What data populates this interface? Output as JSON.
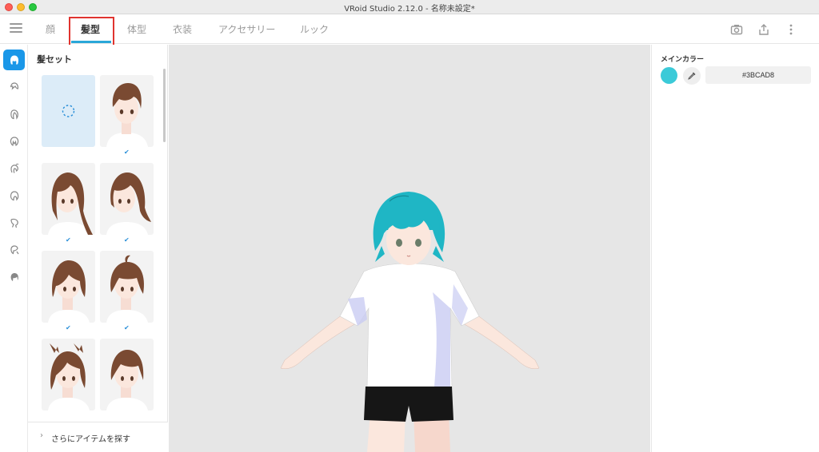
{
  "window": {
    "title": "VRoid Studio 2.12.0 - 名称未設定*"
  },
  "tabs": [
    {
      "label": "顔",
      "active": false
    },
    {
      "label": "髪型",
      "active": true
    },
    {
      "label": "体型",
      "active": false
    },
    {
      "label": "衣装",
      "active": false
    },
    {
      "label": "アクセサリー",
      "active": false
    },
    {
      "label": "ルック",
      "active": false
    }
  ],
  "toolbar_icons": [
    "camera-icon",
    "export-icon",
    "more-vertical-icon"
  ],
  "rail_icons": [
    "hair-set-icon",
    "front-hair-icon",
    "back-hair-icon",
    "side-hair-icon",
    "ahoge-icon",
    "base-hair-icon",
    "sub-hair-icon",
    "hair-extra-icon",
    "hair-edit-icon"
  ],
  "panel": {
    "title": "髪セット",
    "more_label": "さらにアイテムを探す",
    "items": [
      {
        "name": "loading-slot",
        "checked": false
      },
      {
        "name": "short-hair",
        "checked": true
      },
      {
        "name": "long-straight-hair",
        "checked": true
      },
      {
        "name": "medium-hair",
        "checked": true
      },
      {
        "name": "bob-hair",
        "checked": true
      },
      {
        "name": "ahoge-bob-hair",
        "checked": true
      },
      {
        "name": "bun-hair",
        "checked": true
      },
      {
        "name": "short-bob-hair",
        "checked": true
      }
    ]
  },
  "properties": {
    "main_color_label": "メインカラー",
    "main_color_hex": "#3BCAD8",
    "main_color": "#3BCAD8"
  },
  "colors": {
    "accent": "#1a97e8",
    "tab_underline": "#2aa7d9",
    "highlight_box": "#e0342f",
    "viewport_bg": "#e6e6e6",
    "hair_brown": "#7a4a32"
  }
}
